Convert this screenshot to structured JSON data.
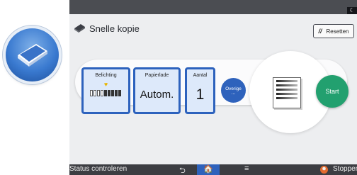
{
  "app_icon": {
    "name": "book-icon"
  },
  "header": {
    "title": "Snelle kopie",
    "reset_label": "Resetten",
    "night_icon": "☾"
  },
  "tiles": {
    "exposure": {
      "label": "Belichting",
      "level": 4,
      "steps": 9
    },
    "paper": {
      "label": "Papierlade",
      "value": "Autom."
    },
    "quantity": {
      "label": "Aantal",
      "value": "1"
    }
  },
  "other_button": {
    "label": "Overige",
    "dots": "..."
  },
  "start_button": {
    "label": "Start"
  },
  "bottom_bar": {
    "status_label": "Status controleren",
    "back_icon": "⮌",
    "home_icon": "🏠",
    "menu_icon": "≡",
    "stop_label": "Stoppen"
  },
  "colors": {
    "accent": "#2e62bc",
    "start": "#22a06f",
    "stop": "#e36a2e"
  }
}
